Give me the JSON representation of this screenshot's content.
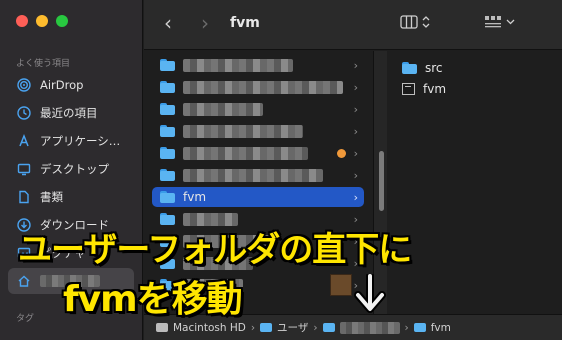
{
  "window": {
    "title": "fvm"
  },
  "sidebar": {
    "section_label": "よく使う項目",
    "items": [
      {
        "label": "AirDrop",
        "icon": "airdrop-icon"
      },
      {
        "label": "最近の項目",
        "icon": "clock-icon"
      },
      {
        "label": "アプリケーシ…",
        "icon": "applications-icon"
      },
      {
        "label": "デスクトップ",
        "icon": "desktop-icon"
      },
      {
        "label": "書類",
        "icon": "document-icon"
      },
      {
        "label": "ダウンロード",
        "icon": "download-icon"
      },
      {
        "label": "ピクチャ",
        "icon": "pictures-icon"
      },
      {
        "label": "",
        "icon": "home-icon"
      }
    ],
    "tags_label": "タグ"
  },
  "column1": {
    "selected_label": "fvm"
  },
  "column2": {
    "items": [
      {
        "label": "src",
        "icon": "folder-icon"
      },
      {
        "label": "fvm",
        "icon": "file-icon"
      }
    ]
  },
  "pathbar": {
    "segments": [
      "Macintosh HD",
      "ユーザ",
      "",
      "fvm"
    ]
  },
  "overlay": {
    "line1": "ユーザーフォルダの直下に",
    "line2": "fvmを移動"
  },
  "colors": {
    "accent": "#2358c6",
    "caption": "#ffe600",
    "folder": "#5ab4f2"
  }
}
